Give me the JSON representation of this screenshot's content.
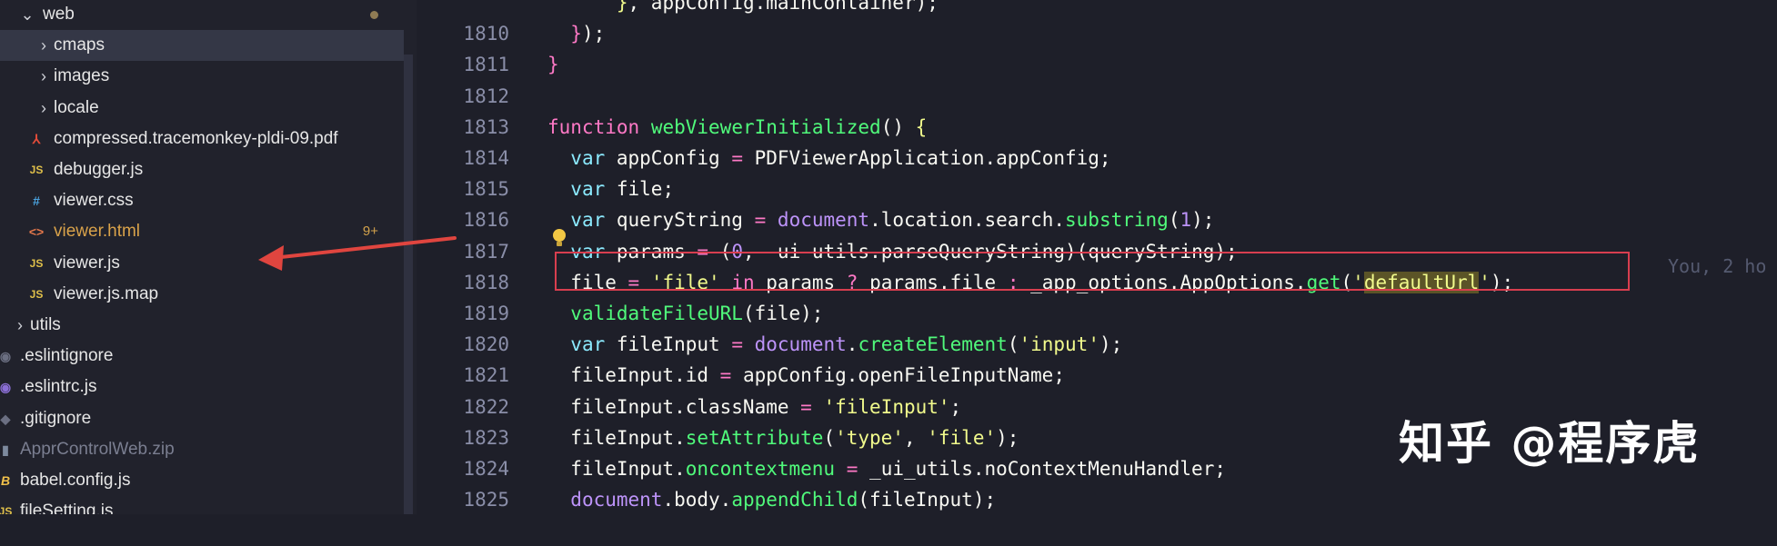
{
  "explorer": {
    "items": [
      {
        "name": "tree-folder-web",
        "label": "web",
        "chevron": "⌄",
        "icon": "",
        "icon_class": "",
        "dim": false,
        "badge": "",
        "dot": true,
        "indent": 22,
        "sel": false
      },
      {
        "name": "tree-folder-cmaps",
        "label": "cmaps",
        "chevron": "›",
        "icon": "",
        "icon_class": "",
        "dim": false,
        "badge": "",
        "dot": false,
        "indent": 40,
        "sel": true
      },
      {
        "name": "tree-folder-images",
        "label": "images",
        "chevron": "›",
        "icon": "",
        "icon_class": "",
        "dim": false,
        "badge": "",
        "dot": false,
        "indent": 40,
        "sel": false
      },
      {
        "name": "tree-folder-locale",
        "label": "locale",
        "chevron": "›",
        "icon": "",
        "icon_class": "",
        "dim": false,
        "badge": "",
        "dot": false,
        "indent": 40,
        "sel": false
      },
      {
        "name": "tree-file-pdf",
        "label": "compressed.tracemonkey-pldi-09.pdf",
        "chevron": "",
        "icon": "⅄",
        "icon_class": "pdf-ic",
        "dim": false,
        "badge": "",
        "dot": false,
        "indent": 40,
        "sel": false
      },
      {
        "name": "tree-file-debugger-js",
        "label": "debugger.js",
        "chevron": "",
        "icon": "JS",
        "icon_class": "js-ic",
        "dim": false,
        "badge": "",
        "dot": false,
        "indent": 40,
        "sel": false
      },
      {
        "name": "tree-file-viewer-css",
        "label": "viewer.css",
        "chevron": "",
        "icon": "#",
        "icon_class": "css-ic",
        "dim": false,
        "badge": "",
        "dot": false,
        "indent": 40,
        "sel": false
      },
      {
        "name": "tree-file-viewer-html",
        "label": "viewer.html",
        "chevron": "",
        "icon": "<>",
        "icon_class": "html-ic",
        "dim": false,
        "badge": "9+",
        "dot": false,
        "indent": 40,
        "sel": false,
        "color": "#d9a24a"
      },
      {
        "name": "tree-file-viewer-js",
        "label": "viewer.js",
        "chevron": "",
        "icon": "JS",
        "icon_class": "js-ic",
        "dim": false,
        "badge": "",
        "dot": false,
        "indent": 40,
        "sel": false
      },
      {
        "name": "tree-file-viewer-js-map",
        "label": "viewer.js.map",
        "chevron": "",
        "icon": "JS",
        "icon_class": "js-ic",
        "dim": false,
        "badge": "",
        "dot": false,
        "indent": 40,
        "sel": false
      },
      {
        "name": "tree-folder-utils",
        "label": "utils",
        "chevron": "›",
        "icon": "",
        "icon_class": "",
        "dim": false,
        "badge": "",
        "dot": false,
        "indent": 14,
        "sel": false
      },
      {
        "name": "tree-file-eslintignore",
        "label": ".eslintignore",
        "chevron": "",
        "icon": "◉",
        "icon_class": "ign-ic",
        "dim": false,
        "badge": "",
        "dot": false,
        "indent": 0,
        "sel": false
      },
      {
        "name": "tree-file-eslintrc",
        "label": ".eslintrc.js",
        "chevron": "",
        "icon": "◉",
        "icon_class": "esl-ic",
        "dim": false,
        "badge": "",
        "dot": false,
        "indent": 0,
        "sel": false
      },
      {
        "name": "tree-file-gitignore",
        "label": ".gitignore",
        "chevron": "",
        "icon": "◆",
        "icon_class": "ign-ic",
        "dim": false,
        "badge": "",
        "dot": false,
        "indent": 0,
        "sel": false
      },
      {
        "name": "tree-file-zip",
        "label": "ApprControlWeb.zip",
        "chevron": "",
        "icon": "▮",
        "icon_class": "zip-ic",
        "dim": true,
        "badge": "",
        "dot": false,
        "indent": 0,
        "sel": false
      },
      {
        "name": "tree-file-babel-config",
        "label": "babel.config.js",
        "chevron": "",
        "icon": "B",
        "icon_class": "bab-ic",
        "dim": false,
        "badge": "",
        "dot": false,
        "indent": 0,
        "sel": false
      },
      {
        "name": "tree-file-filesetting",
        "label": "fileSetting.js",
        "chevron": "",
        "icon": "JS",
        "icon_class": "js-ic",
        "dim": false,
        "badge": "",
        "dot": false,
        "indent": 0,
        "sel": false
      }
    ]
  },
  "editor": {
    "lines": [
      {
        "n": "",
        "html": "      <span class=\"br1\">}</span>, appConfig.mainContainer);"
      },
      {
        "n": "1810",
        "html": "  <span class=\"br2\">}</span>);"
      },
      {
        "n": "1811",
        "html": "<span class=\"br2\">}</span>"
      },
      {
        "n": "1812",
        "html": ""
      },
      {
        "n": "1813",
        "html": "<span class=\"pk\">function</span> <span class=\"fn\">webViewerInitialized</span>() <span class=\"br1\">{</span>"
      },
      {
        "n": "1814",
        "html": "  <span class=\"kw\">var</span> appConfig <span class=\"pk\">=</span> PDFViewerApplication.appConfig;"
      },
      {
        "n": "1815",
        "html": "  <span class=\"kw\">var</span> file;"
      },
      {
        "n": "1816",
        "html": "  <span class=\"kw\">var</span> queryString <span class=\"pk\">=</span> <span class=\"nm\">document</span>.location.search.<span class=\"fn\">substring</span>(<span class=\"nm\">1</span>);"
      },
      {
        "n": "1817",
        "html": "  <span class=\"kw\">var</span> params <span class=\"pk\">=</span> (<span class=\"nm\">0</span>,  ui utils.parseQueryString)(queryString);"
      },
      {
        "n": "1818",
        "html": "  file <span class=\"pk\">=</span> <span class=\"st\">'file'</span> <span class=\"pk\">in</span> params <span class=\"pk\">?</span> params.file <span class=\"pk\">:</span> _app_options.AppOptions.<span class=\"fn\">get</span>(<span class=\"st\">'</span><span class=\"hl-str\">defaultUrl</span><span class=\"st\">'</span>);"
      },
      {
        "n": "1819",
        "html": "  <span class=\"fn\">validateFileURL</span>(file);"
      },
      {
        "n": "1820",
        "html": "  <span class=\"kw\">var</span> fileInput <span class=\"pk\">=</span> <span class=\"nm\">document</span>.<span class=\"fn\">createElement</span>(<span class=\"st\">'input'</span>);"
      },
      {
        "n": "1821",
        "html": "  fileInput.id <span class=\"pk\">=</span> appConfig.openFileInputName;"
      },
      {
        "n": "1822",
        "html": "  fileInput.className <span class=\"pk\">=</span> <span class=\"st\">'fileInput'</span>;"
      },
      {
        "n": "1823",
        "html": "  fileInput.<span class=\"fn\">setAttribute</span>(<span class=\"st\">'type'</span>, <span class=\"st\">'file'</span>);"
      },
      {
        "n": "1824",
        "html": "  fileInput.<span class=\"fn\">oncontextmenu</span> <span class=\"pk\">=</span> _ui_utils.noContextMenuHandler;"
      },
      {
        "n": "1825",
        "html": "  <span class=\"nm\">document</span>.body.<span class=\"fn\">appendChild</span>(fileInput);"
      },
      {
        "n": "",
        "html": ""
      }
    ],
    "blame": "You, 2 ho"
  },
  "watermark": "知乎 @程序虎"
}
